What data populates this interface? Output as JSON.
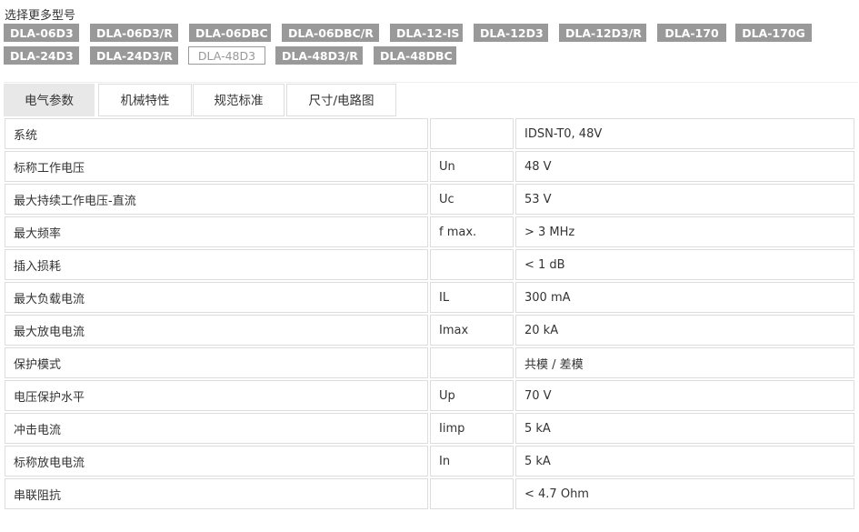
{
  "header": {
    "select_more_models": "选择更多型号"
  },
  "models": [
    "DLA-06D3",
    "DLA-06D3/R",
    "DLA-06DBC",
    "DLA-06DBC/R",
    "DLA-12-IS",
    "DLA-12D3",
    "DLA-12D3/R",
    "DLA-170",
    "DLA-170G",
    "DLA-24D3",
    "DLA-24D3/R",
    "DLA-48D3",
    "DLA-48D3/R",
    "DLA-48DBC"
  ],
  "active_model": "DLA-48D3",
  "tabs": [
    "电气参数",
    "机械特性",
    "规范标准",
    "尺寸/电路图"
  ],
  "active_tab": "电气参数",
  "spec_rows": [
    {
      "name": "系统",
      "symbol": "",
      "value": "IDSN-T0, 48V"
    },
    {
      "name": "标称工作电压",
      "symbol": "Un",
      "value": "48 V"
    },
    {
      "name": "最大持续工作电压-直流",
      "symbol": "Uc",
      "value": "53 V"
    },
    {
      "name": "最大频率",
      "symbol": "f max.",
      "value": "> 3 MHz"
    },
    {
      "name": "插入损耗",
      "symbol": "",
      "value": "< 1 dB"
    },
    {
      "name": "最大负载电流",
      "symbol": "IL",
      "value": "300 mA"
    },
    {
      "name": "最大放电电流",
      "symbol": "Imax",
      "value": "20 kA"
    },
    {
      "name": "保护模式",
      "symbol": "",
      "value": "共模 / 差模"
    },
    {
      "name": "电压保护水平",
      "symbol": "Up",
      "value": "70 V"
    },
    {
      "name": "冲击电流",
      "symbol": "Iimp",
      "value": "5 kA"
    },
    {
      "name": "标称放电电流",
      "symbol": "In",
      "value": "5 kA"
    },
    {
      "name": "串联阻抗",
      "symbol": "",
      "value": "< 4.7 Ohm"
    }
  ]
}
